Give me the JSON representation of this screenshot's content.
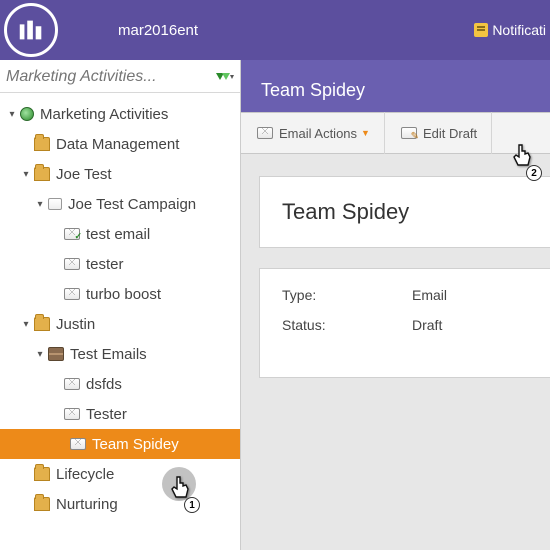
{
  "header": {
    "org": "mar2016ent",
    "notifications": "Notificati"
  },
  "sidebar": {
    "search_placeholder": "Marketing Activities...",
    "root": "Marketing Activities",
    "nodes": {
      "data_management": "Data Management",
      "joe_test": "Joe Test",
      "joe_test_campaign": "Joe Test Campaign",
      "test_email": "test email",
      "tester": "tester",
      "turbo_boost": "turbo boost",
      "justin": "Justin",
      "test_emails": "Test Emails",
      "dsfds": "dsfds",
      "tester2": "Tester",
      "team_spidey": "Team Spidey",
      "lifecycle": "Lifecycle",
      "nurturing": "Nurturing"
    }
  },
  "main": {
    "tab_title": "Team Spidey",
    "toolbar": {
      "email_actions": "Email Actions",
      "edit_draft": "Edit Draft"
    },
    "panel_title": "Team Spidey",
    "details": {
      "type_label": "Type:",
      "type_value": "Email",
      "status_label": "Status:",
      "status_value": "Draft"
    }
  },
  "cursors": {
    "step1": "1",
    "step2": "2"
  }
}
